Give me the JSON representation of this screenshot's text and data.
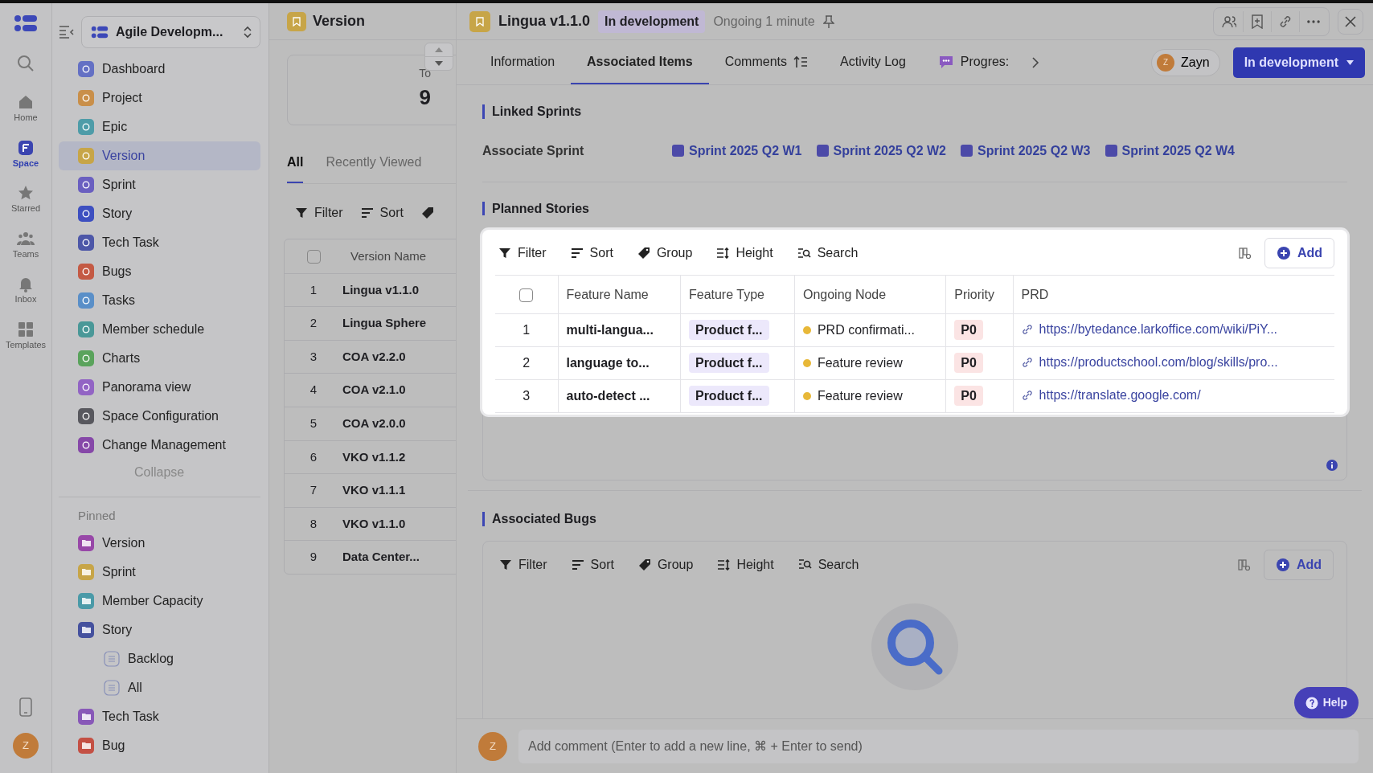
{
  "rail": {
    "items": [
      {
        "label": "Home",
        "selected": false
      },
      {
        "label": "Space",
        "selected": true
      },
      {
        "label": "Starred",
        "selected": false
      },
      {
        "label": "Teams",
        "selected": false
      },
      {
        "label": "Inbox",
        "selected": false
      },
      {
        "label": "Templates",
        "selected": false
      }
    ],
    "avatar": "Z"
  },
  "workspace": {
    "name": "Agile Developm..."
  },
  "nav": {
    "items": [
      {
        "label": "Dashboard",
        "color": "#6470c4",
        "selected": false
      },
      {
        "label": "Project",
        "color": "#c98f4a",
        "selected": false
      },
      {
        "label": "Epic",
        "color": "#4e9ca8",
        "selected": false
      },
      {
        "label": "Version",
        "color": "#c7a548",
        "selected": true
      },
      {
        "label": "Sprint",
        "color": "#6a5fc0",
        "selected": false
      },
      {
        "label": "Story",
        "color": "#3d4fc0",
        "selected": false
      },
      {
        "label": "Tech Task",
        "color": "#4d57a8",
        "selected": false
      },
      {
        "label": "Bugs",
        "color": "#c45a44",
        "selected": false
      },
      {
        "label": "Tasks",
        "color": "#5a8fc8",
        "selected": false
      },
      {
        "label": "Member schedule",
        "color": "#4a9898",
        "selected": false
      },
      {
        "label": "Charts",
        "color": "#5aa35c",
        "selected": false
      },
      {
        "label": "Panorama view",
        "color": "#9264c4",
        "selected": false
      },
      {
        "label": "Space Configuration",
        "color": "#58585e",
        "selected": false
      },
      {
        "label": "Change Management",
        "color": "#8648a8",
        "selected": false
      }
    ],
    "collapse": "Collapse"
  },
  "pinned": {
    "title": "Pinned",
    "items": [
      {
        "label": "Version",
        "color": "#9848a8"
      },
      {
        "label": "Sprint",
        "color": "#c7a548"
      },
      {
        "label": "Member Capacity",
        "color": "#4a9aa8"
      },
      {
        "label": "Story",
        "color": "#45519e",
        "children": [
          {
            "label": "Backlog"
          },
          {
            "label": "All"
          }
        ]
      },
      {
        "label": "Tech Task",
        "color": "#8858b8"
      },
      {
        "label": "Bug",
        "color": "#c45044"
      }
    ]
  },
  "list_panel": {
    "title": "Version",
    "stat_label": "To",
    "stat_value": "9",
    "tabs": [
      {
        "label": "All",
        "selected": true
      },
      {
        "label": "Recently Viewed",
        "selected": false
      }
    ],
    "toolbar": [
      "Filter",
      "Sort"
    ],
    "table": {
      "select_all_checked": false,
      "columns": [
        "Version Name"
      ],
      "rows": [
        {
          "index": "1",
          "name": "Lingua v1.1.0"
        },
        {
          "index": "2",
          "name": "Lingua Sphere"
        },
        {
          "index": "3",
          "name": "COA v2.2.0"
        },
        {
          "index": "4",
          "name": "COA v2.1.0"
        },
        {
          "index": "5",
          "name": "COA v2.0.0"
        },
        {
          "index": "6",
          "name": "VKO v1.1.2"
        },
        {
          "index": "7",
          "name": "VKO v1.1.1"
        },
        {
          "index": "8",
          "name": "VKO v1.1.0"
        },
        {
          "index": "9",
          "name": "Data Center..."
        }
      ]
    }
  },
  "detail": {
    "title": "Lingua v1.1.0",
    "status_badge": "In development",
    "duration": "Ongoing 1 minute",
    "tabs": [
      {
        "label": "Information",
        "selected": false
      },
      {
        "label": "Associated Items",
        "selected": true
      },
      {
        "label": "Comments",
        "selected": false
      },
      {
        "label": "Activity Log",
        "selected": false
      },
      {
        "label": "Progres:",
        "selected": false
      }
    ],
    "assignee": {
      "initial": "Z",
      "name": "Zayn"
    },
    "status_button": "In development",
    "linked_sprints": {
      "title": "Linked Sprints",
      "label": "Associate Sprint",
      "sprints": [
        "Sprint 2025 Q2 W1",
        "Sprint 2025 Q2 W2",
        "Sprint 2025 Q2 W3",
        "Sprint 2025 Q2 W4"
      ]
    },
    "planned_stories": {
      "title": "Planned Stories",
      "toolbar": [
        "Filter",
        "Sort",
        "Group",
        "Height",
        "Search"
      ],
      "add": "Add",
      "select_all_checked": false,
      "columns": [
        "Feature Name",
        "Feature Type",
        "Ongoing Node",
        "Priority",
        "PRD"
      ],
      "rows": [
        {
          "index": "1",
          "name": "multi-langua...",
          "type": "Product f...",
          "node": "PRD confirmati...",
          "priority": "P0",
          "prd": "https://bytedance.larkoffice.com/wiki/PiY..."
        },
        {
          "index": "2",
          "name": "language to...",
          "type": "Product f...",
          "node": "Feature review",
          "priority": "P0",
          "prd": "https://productschool.com/blog/skills/pro..."
        },
        {
          "index": "3",
          "name": "auto-detect ...",
          "type": "Product f...",
          "node": "Feature review",
          "priority": "P0",
          "prd": "https://translate.google.com/"
        }
      ]
    },
    "associated_bugs": {
      "title": "Associated Bugs",
      "toolbar": [
        "Filter",
        "Sort",
        "Group",
        "Height",
        "Search"
      ],
      "add": "Add"
    },
    "comment": {
      "initial": "Z",
      "placeholder": "Add comment (Enter to add a new line, ⌘ + Enter to send)"
    }
  },
  "help": "Help"
}
